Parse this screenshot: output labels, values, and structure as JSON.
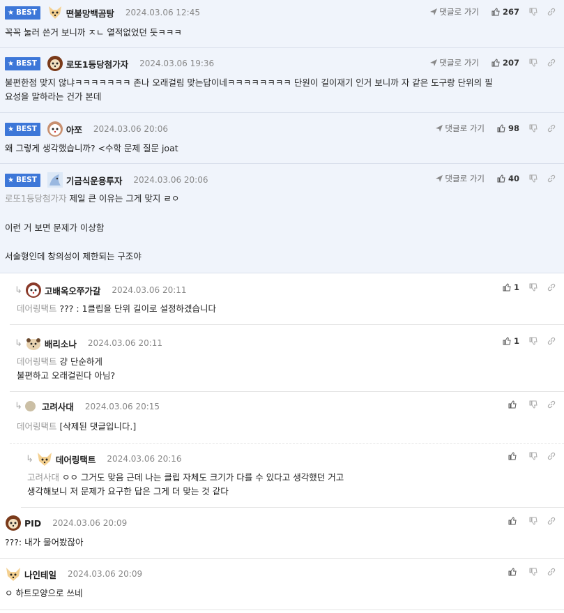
{
  "actions": {
    "goto_label": "댓글로 가기",
    "best_label": "BEST"
  },
  "comments": [
    {
      "nick": "떤불망백곰탕",
      "date": "2024.03.06 12:45",
      "likes": "267",
      "lines": [
        "꼭꼭 눌러 쓴거 보니까 ㅈㄴ 열적없었던 듯ㅋㅋㅋ"
      ]
    },
    {
      "nick": "로또1등당첨가자",
      "date": "2024.03.06 19:36",
      "likes": "207",
      "lines": [
        "불편한점 맞지 않냐ㅋㅋㅋㅋㅋㅋㅋ 존나 오래걸림 맞는답이네ㅋㅋㅋㅋㅋㅋㅋㅋ 단원이 길이재기 인거 보니까 자 같은 도구랑 단위의 필",
        "요성을 말하라는 건가 본데"
      ]
    },
    {
      "nick": "아쪼",
      "date": "2024.03.06 20:06",
      "likes": "98",
      "lines": [
        "왜 그렇게 생각했습니까? <수학 문제 질문 joat"
      ]
    },
    {
      "nick": "기금식운용투자",
      "date": "2024.03.06 20:06",
      "likes": "40",
      "mention": "로또1등당첨가자",
      "lines": [
        "제일 큰 이유는 그게 맞지 ㄹㅇ",
        "",
        "이런 거 보면 문제가 이상함",
        "",
        "서술형인데 창의성이 제한되는 구조야"
      ]
    }
  ],
  "replies": [
    {
      "nick": "고배옥오쭈가갈",
      "date": "2024.03.06 20:11",
      "likes": "1",
      "mention": "데어링택트",
      "lines": [
        "??? : 1클립을 단위 길이로 설정하겠습니다"
      ]
    },
    {
      "nick": "배리소나",
      "date": "2024.03.06 20:11",
      "likes": "1",
      "mention": "데어링택트",
      "lines": [
        "걍 단순하게",
        "불편하고 오래걸린다 아님?"
      ]
    },
    {
      "nick": "고려사대",
      "date": "2024.03.06 20:15",
      "likes": "",
      "mention": "데어링택트",
      "lines": [
        "[삭제된 댓글입니다.]"
      ]
    },
    {
      "nick": "데어링택트",
      "date": "2024.03.06 20:16",
      "likes": "",
      "mention": "고려사대",
      "lines": [
        "ㅇㅇ 그거도 맞음 근데 나는 클립 자체도 크기가 다를 수 있다고 생각했던 거고",
        "생각해보니 저 문제가 요구한 답은 그게 더 맞는 것 같다"
      ]
    }
  ],
  "plain": [
    {
      "nick": "PID",
      "date": "2024.03.06 20:09",
      "likes": "",
      "lines": [
        "???: 내가 물어봤잖아"
      ]
    },
    {
      "nick": "나인테일",
      "date": "2024.03.06 20:09",
      "likes": "",
      "lines": [
        "ㅇ 하트모양으로 쓰네"
      ]
    }
  ]
}
